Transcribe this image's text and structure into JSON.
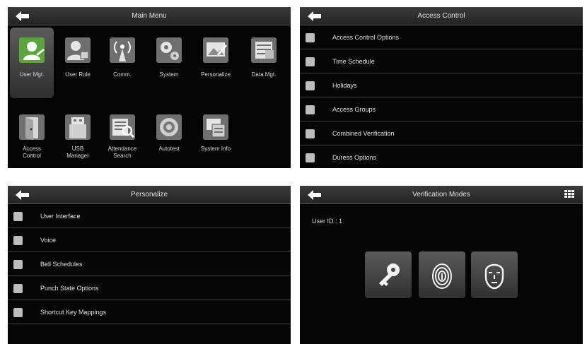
{
  "main_menu": {
    "title": "Main Menu",
    "items": [
      {
        "label": "User Mgt.",
        "icon": "user-mgt-icon"
      },
      {
        "label": "User Role",
        "icon": "user-role-icon"
      },
      {
        "label": "Comm.",
        "icon": "comm-icon"
      },
      {
        "label": "System",
        "icon": "system-gear-icon"
      },
      {
        "label": "Personalize",
        "icon": "personalize-icon"
      },
      {
        "label": "Data Mgt.",
        "icon": "data-mgt-icon"
      },
      {
        "label": "Access\nControl",
        "icon": "access-control-door-icon"
      },
      {
        "label": "USB\nManager",
        "icon": "usb-manager-icon"
      },
      {
        "label": "Attendance\nSearch",
        "icon": "attendance-search-icon"
      },
      {
        "label": "Autotest",
        "icon": "autotest-icon"
      },
      {
        "label": "System Info",
        "icon": "system-info-icon"
      }
    ],
    "selected": "User Mgt."
  },
  "access_control": {
    "title": "Access Control",
    "items": [
      {
        "label": "Access Control Options",
        "icon": "access-options-icon"
      },
      {
        "label": "Time Schedule",
        "icon": "clock-icon"
      },
      {
        "label": "Holidays",
        "icon": "calendar-icon"
      },
      {
        "label": "Access Groups",
        "icon": "group-icon"
      },
      {
        "label": "Combined Verification",
        "icon": "combined-verification-icon"
      },
      {
        "label": "Duress Options",
        "icon": "duress-icon"
      }
    ]
  },
  "personalize": {
    "title": "Personalize",
    "items": [
      {
        "label": "User Interface",
        "icon": "monitor-icon"
      },
      {
        "label": "Voice",
        "icon": "speaker-icon"
      },
      {
        "label": "Bell Schedules",
        "icon": "bell-icon"
      },
      {
        "label": "Punch State Options",
        "icon": "punch-state-icon"
      },
      {
        "label": "Shortcut Key Mappings",
        "icon": "keyboard-icon"
      }
    ]
  },
  "verification": {
    "title": "Verification Modes",
    "user_id": "User ID : 1",
    "modes": [
      {
        "icon": "key-icon"
      },
      {
        "icon": "fingerprint-icon"
      },
      {
        "icon": "face-icon"
      }
    ]
  }
}
